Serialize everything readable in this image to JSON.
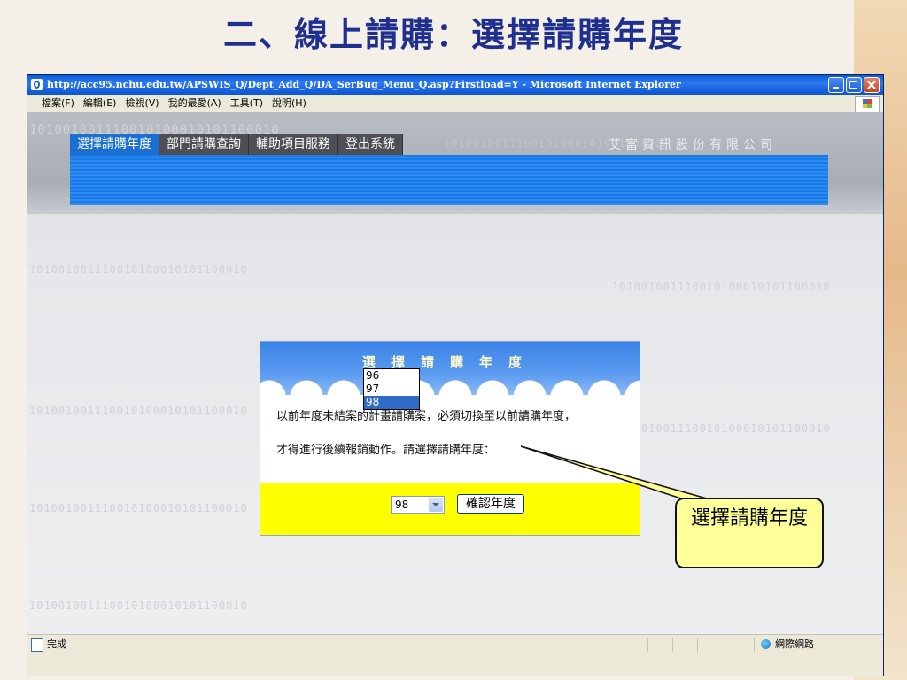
{
  "slide": {
    "title": "二、線上請購：選擇請購年度",
    "callout_text": "選擇請購年度"
  },
  "browser": {
    "title": "http://acc95.nchu.edu.tw/APSWIS_Q/Dept_Add_Q/DA_SerBug_Menu_Q.asp?Firstload=Y - Microsoft Internet Explorer",
    "menu": [
      "檔案(F)",
      "編輯(E)",
      "檢視(V)",
      "我的最愛(A)",
      "工具(T)",
      "說明(H)"
    ],
    "status_text": "完成",
    "zone_text": "網際網路"
  },
  "app": {
    "nav_tabs": [
      "選擇請購年度",
      "部門請購查詢",
      "輔助項目服務",
      "登出系統"
    ],
    "company": "艾富資訊股份有限公司",
    "binary_text": "101001001110010100010101100010"
  },
  "dialog": {
    "title": "選擇請購年度",
    "line1": "以前年度未結案的計畫請購案，必須切換至以前請購年度，",
    "line2": "才得進行後續報銷動作。請選擇請購年度：",
    "selected_year": "98",
    "confirm_label": "確認年度",
    "year_options": [
      "96",
      "97",
      "98"
    ]
  },
  "colors": {
    "accent_blue": "#1b6fd1",
    "dialog_footer": "#ffff00",
    "callout_fill": "#ffff99",
    "title_color": "#1f2f8f"
  }
}
